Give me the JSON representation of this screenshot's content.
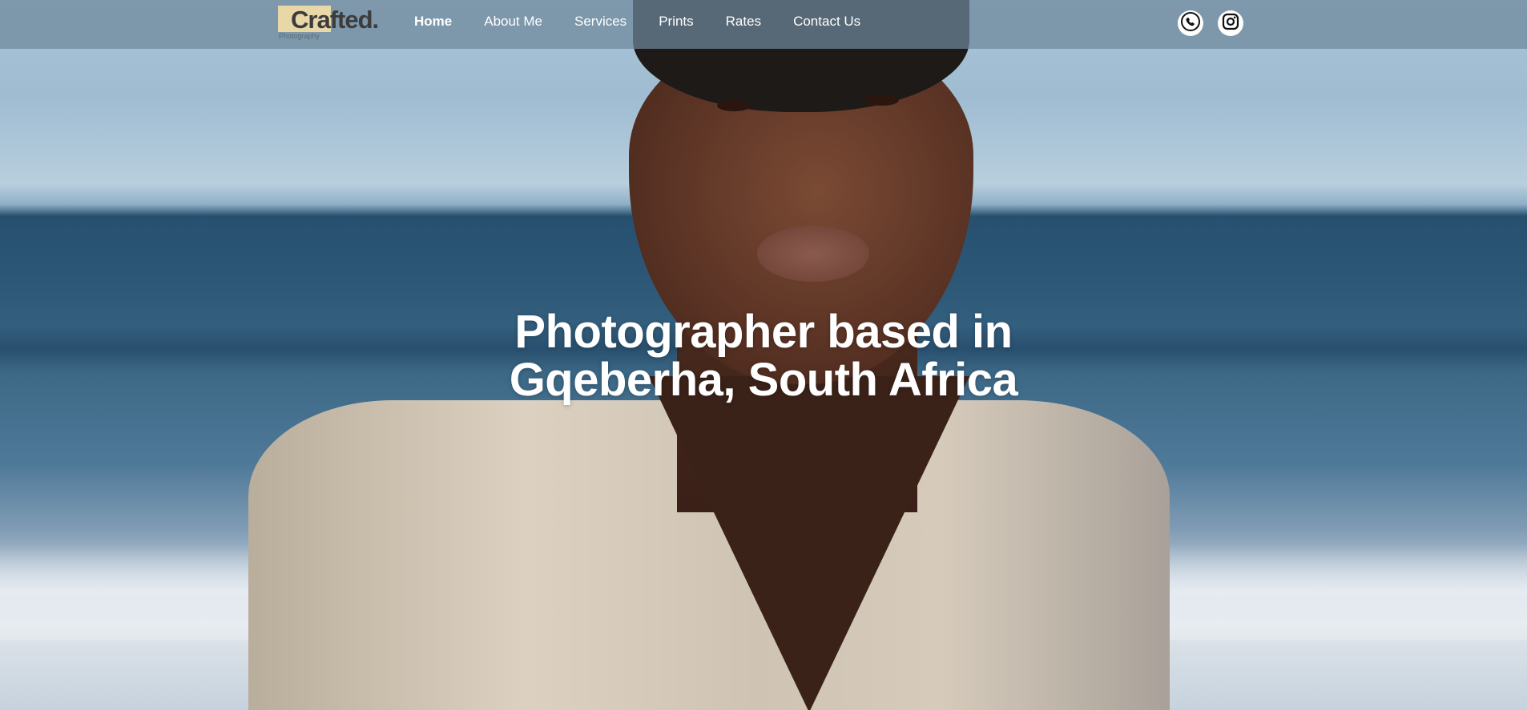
{
  "brand": {
    "name": "Crafted.",
    "tagline": "Photography",
    "accent": "#e8d8a8"
  },
  "nav": {
    "items": [
      {
        "label": "Home",
        "active": true
      },
      {
        "label": "About Me",
        "active": false
      },
      {
        "label": "Services",
        "active": false
      },
      {
        "label": "Prints",
        "active": false
      },
      {
        "label": "Rates",
        "active": false
      },
      {
        "label": "Contact Us",
        "active": false
      }
    ]
  },
  "social": {
    "phone_icon": "whatsapp-icon",
    "instagram_icon": "instagram-icon"
  },
  "hero": {
    "headline_line1": "Photographer based in",
    "headline_line2": "Gqeberha, South Africa",
    "image_subject": "portrait-on-beach"
  }
}
